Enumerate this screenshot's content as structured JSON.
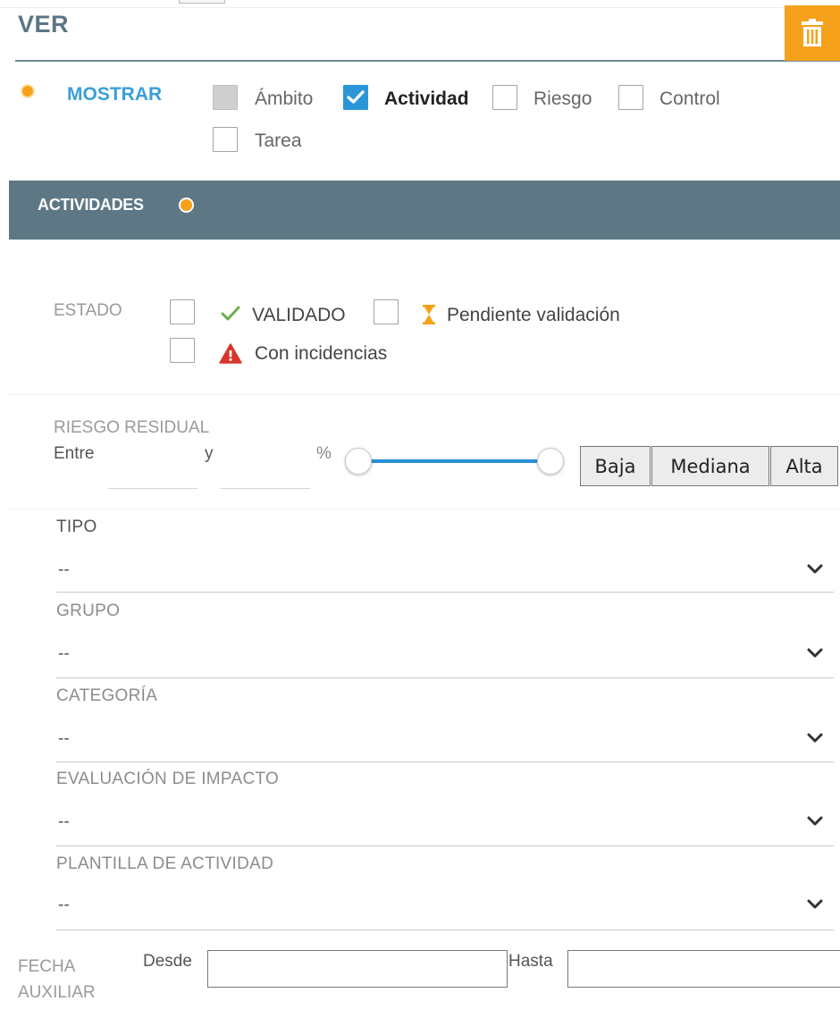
{
  "ver": {
    "title": "VER"
  },
  "mostrar": {
    "label": "MOSTRAR",
    "options": [
      {
        "label": "Ámbito",
        "state": "indeterminate"
      },
      {
        "label": "Actividad",
        "state": "checked"
      },
      {
        "label": "Riesgo",
        "state": "unchecked"
      },
      {
        "label": "Control",
        "state": "unchecked"
      },
      {
        "label": "Tarea",
        "state": "unchecked"
      }
    ]
  },
  "section": {
    "title": "ACTIVIDADES"
  },
  "estado": {
    "label": "ESTADO",
    "validado": "VALIDADO",
    "pendiente": "Pendiente validación",
    "incidencias": "Con incidencias"
  },
  "riesgo": {
    "label": "RIESGO RESIDUAL",
    "entre": "Entre",
    "y": "y",
    "percent": "%",
    "min_value": "",
    "max_value": "",
    "range": [
      0,
      100
    ],
    "buttons": [
      "Baja",
      "Mediana",
      "Alta"
    ]
  },
  "dropdowns": [
    {
      "label": "TIPO",
      "value": "--"
    },
    {
      "label": "GRUPO",
      "value": "--"
    },
    {
      "label": "CATEGORÍA",
      "value": "--"
    },
    {
      "label": "EVALUACIÓN DE IMPACTO",
      "value": "--"
    },
    {
      "label": "PLANTILLA DE ACTIVIDAD",
      "value": "--"
    }
  ],
  "fecha": {
    "label_line1": "FECHA",
    "label_line2": "AUXILIAR",
    "desde": "Desde",
    "hasta": "Hasta"
  },
  "colors": {
    "accent_orange": "#f5a11b",
    "accent_blue": "#3a9fd8",
    "section_bg": "#5d7785",
    "valid_green": "#6ab04c",
    "warning_red": "#d9342b"
  }
}
